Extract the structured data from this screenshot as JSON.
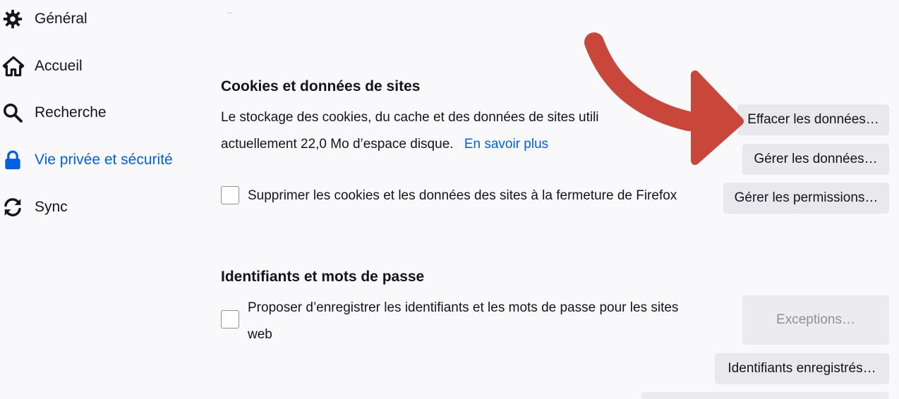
{
  "sidebar": {
    "items": [
      {
        "label": "Général",
        "icon": "gear-icon"
      },
      {
        "label": "Accueil",
        "icon": "home-icon"
      },
      {
        "label": "Recherche",
        "icon": "search-icon"
      },
      {
        "label": "Vie privée et sécurité",
        "icon": "lock-icon",
        "active": true
      },
      {
        "label": "Sync",
        "icon": "sync-icon"
      }
    ]
  },
  "cookies": {
    "title": "Cookies et données de sites",
    "description_line1": "Le stockage des cookies, du cache et des données de sites utili",
    "description_line2": "actuellement 22,0 Mo d’espace disque.",
    "learn_more": "En savoir plus",
    "delete_on_close_label": "Supprimer les cookies et les données des sites à la fermeture de Firefox",
    "clear_data_button": "Effacer les données…",
    "manage_data_button": "Gérer les données…",
    "manage_permissions_button": "Gérer les permissions…"
  },
  "logins": {
    "title": "Identifiants et mots de passe",
    "offer_save_line1": "Proposer d’enregistrer les identifiants et les mots de passe pour les sites",
    "offer_save_line2": "web",
    "exceptions_button": "Exceptions…",
    "saved_logins_button": "Identifiants enregistrés…"
  },
  "colors": {
    "accent": "#0061e0",
    "annotation_arrow": "#c9473a"
  }
}
